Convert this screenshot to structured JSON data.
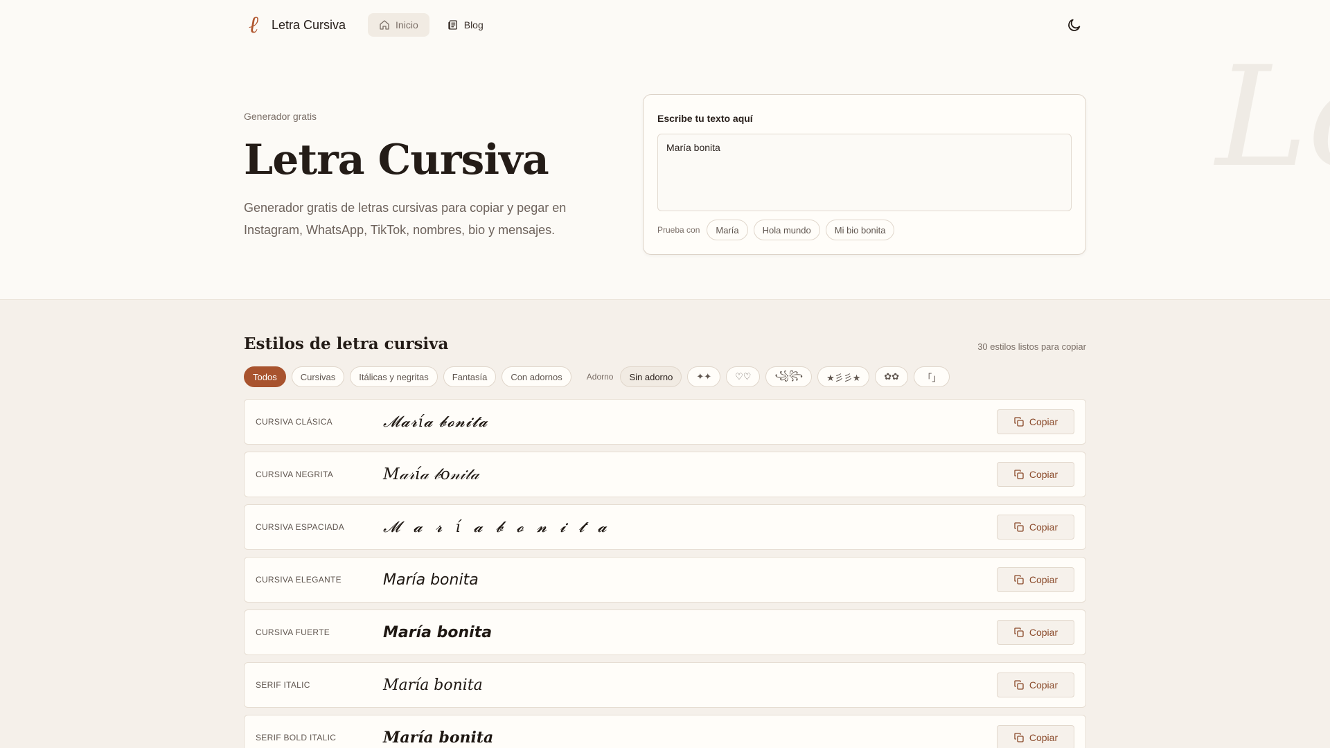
{
  "header": {
    "logo_mark": "ℓ",
    "brand": "Letra Cursiva",
    "nav": [
      {
        "label": "Inicio",
        "icon": "home-icon",
        "active": true
      },
      {
        "label": "Blog",
        "icon": "newspaper-icon",
        "active": false
      }
    ],
    "theme_icon": "moon-icon"
  },
  "hero": {
    "eyebrow": "Generador gratis",
    "title": "Letra Cursiva",
    "description": "Generador gratis de letras cursivas para copiar y pegar en Instagram, WhatsApp, TikTok, nombres, bio y mensajes.",
    "background_letters": "Lc"
  },
  "input": {
    "label": "Escribe tu texto aquí",
    "value": "María bonita",
    "suggest_label": "Prueba con",
    "suggestions": [
      "María",
      "Hola mundo",
      "Mi bio bonita"
    ]
  },
  "styles": {
    "title": "Estilos de letra cursiva",
    "count": "30 estilos listos para copiar",
    "filters": [
      "Todos",
      "Cursivas",
      "Itálicas y negritas",
      "Fantasía",
      "Con adornos"
    ],
    "adorno_label": "Adorno",
    "adornos": [
      "Sin adorno",
      "✦✦",
      "♡♡",
      "꧁꧂",
      "★彡彡★",
      "✿✿",
      "「」"
    ],
    "copy_label": "Copiar",
    "items": [
      {
        "name": "CURSIVA CLÁSICA",
        "preview": "𝓜𝓪𝓻í𝓪 𝓫𝓸𝓷𝓲𝓽𝓪"
      },
      {
        "name": "CURSIVA NEGRITA",
        "preview": "𝑀𝒶𝓇í𝒶 𝒷𝑜𝓃𝒾𝓉𝒶"
      },
      {
        "name": "CURSIVA ESPACIADA",
        "preview": "𝓜 𝓪 𝓻 í 𝓪  𝓫 𝓸 𝓷 𝓲 𝓽 𝓪"
      },
      {
        "name": "CURSIVA ELEGANTE",
        "preview": "𝘔𝘢𝘳í𝘢 𝘣𝘰𝘯𝘪𝘵𝘢"
      },
      {
        "name": "CURSIVA FUERTE",
        "preview": "𝙈𝙖𝙧í𝙖 𝙗𝙤𝙣𝙞𝙩𝙖"
      },
      {
        "name": "SERIF ITALIC",
        "preview": "𝑀𝑎𝑟í𝑎 𝑏𝑜𝑛𝑖𝑡𝑎"
      },
      {
        "name": "SERIF BOLD ITALIC",
        "preview": "𝑴𝒂𝒓í𝒂 𝒃𝒐𝒏𝒊𝒕𝒂"
      }
    ]
  },
  "colors": {
    "accent": "#a8532e",
    "background": "#fcfaf6",
    "section_background": "#f5f0ea"
  }
}
